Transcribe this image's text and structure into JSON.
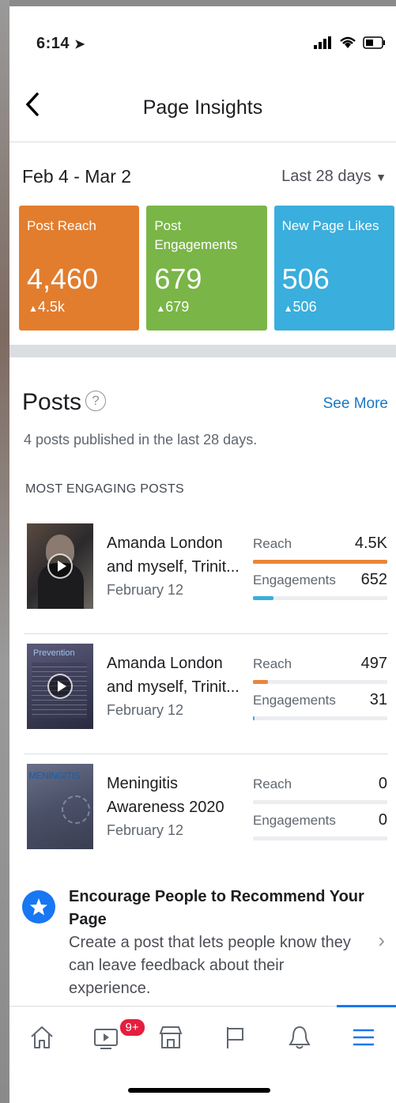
{
  "status": {
    "time": "6:14"
  },
  "nav": {
    "title": "Page Insights"
  },
  "dates": {
    "range": "Feb 4 - Mar 2",
    "period": "Last 28 days"
  },
  "cards": [
    {
      "label": "Post Reach",
      "value": "4,460",
      "delta": "4.5k",
      "color": "#e27d2e"
    },
    {
      "label": "Post Engagements",
      "value": "679",
      "delta": "679",
      "color": "#7ab547"
    },
    {
      "label": "New Page Likes",
      "value": "506",
      "delta": "506",
      "color": "#3aaedc"
    }
  ],
  "posts": {
    "title": "Posts",
    "help": "?",
    "see_more": "See More",
    "subtitle": "4 posts published in the last 28 days.",
    "section_label": "MOST ENGAGING POSTS",
    "reach_label": "Reach",
    "engagements_label": "Engagements",
    "items": [
      {
        "title": "Amanda London and myself, Trinit...",
        "date": "February 12",
        "reach": "4.5K",
        "engagements": "652",
        "reach_fraction": 1.0,
        "engagement_fraction": 0.15
      },
      {
        "title": "Amanda London and myself, Trinit...",
        "date": "February 12",
        "reach": "497",
        "engagements": "31",
        "reach_fraction": 0.11,
        "engagement_fraction": 0.01
      },
      {
        "title": "Meningitis Awareness 2020",
        "date": "February 12",
        "reach": "0",
        "engagements": "0",
        "reach_fraction": 0,
        "engagement_fraction": 0
      }
    ],
    "thumb_texts": {
      "prevention": "Prevention",
      "meningitis": "MENINGITIS"
    }
  },
  "encourage": {
    "title": "Encourage People to Recommend Your Page",
    "body": "Create a post that lets people know they can leave feedback about their experience."
  },
  "tabbar": {
    "video_badge": "9+"
  },
  "colors": {
    "reach_bar": "#e8873a",
    "engagement_bar": "#3aaedc",
    "link": "#1877c5"
  }
}
